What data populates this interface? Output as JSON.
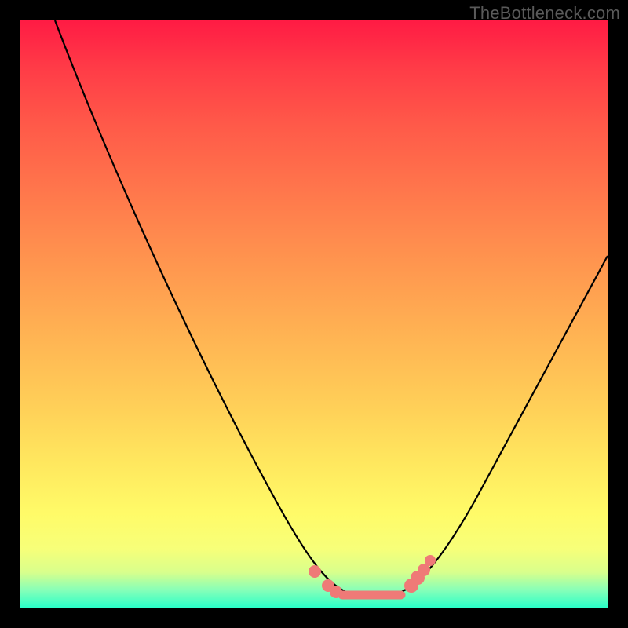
{
  "watermark": {
    "text": "TheBottleneck.com"
  },
  "colors": {
    "background": "#000000",
    "curve": "#000000",
    "marker": "#ef7a77",
    "gradient_top": "#ff1b44",
    "gradient_bottom": "#2bffc8"
  },
  "chart_data": {
    "type": "line",
    "title": "",
    "xlabel": "",
    "ylabel": "",
    "xlim": [
      0,
      100
    ],
    "ylim": [
      0,
      100
    ],
    "x": [
      0,
      5,
      10,
      15,
      20,
      25,
      30,
      35,
      40,
      45,
      50,
      53,
      56,
      59,
      62,
      65,
      70,
      75,
      80,
      85,
      90,
      95,
      100
    ],
    "values": [
      100,
      92,
      83,
      74,
      65,
      55,
      45,
      35,
      25,
      15,
      7,
      3,
      1,
      0,
      0,
      1,
      5,
      12,
      20,
      29,
      38,
      48,
      58
    ],
    "annotations": {
      "floor_segment_x": [
        53,
        65
      ],
      "left_marker_points_x": [
        50,
        52,
        54
      ],
      "right_marker_points_x": [
        66,
        67,
        68,
        70
      ]
    }
  }
}
